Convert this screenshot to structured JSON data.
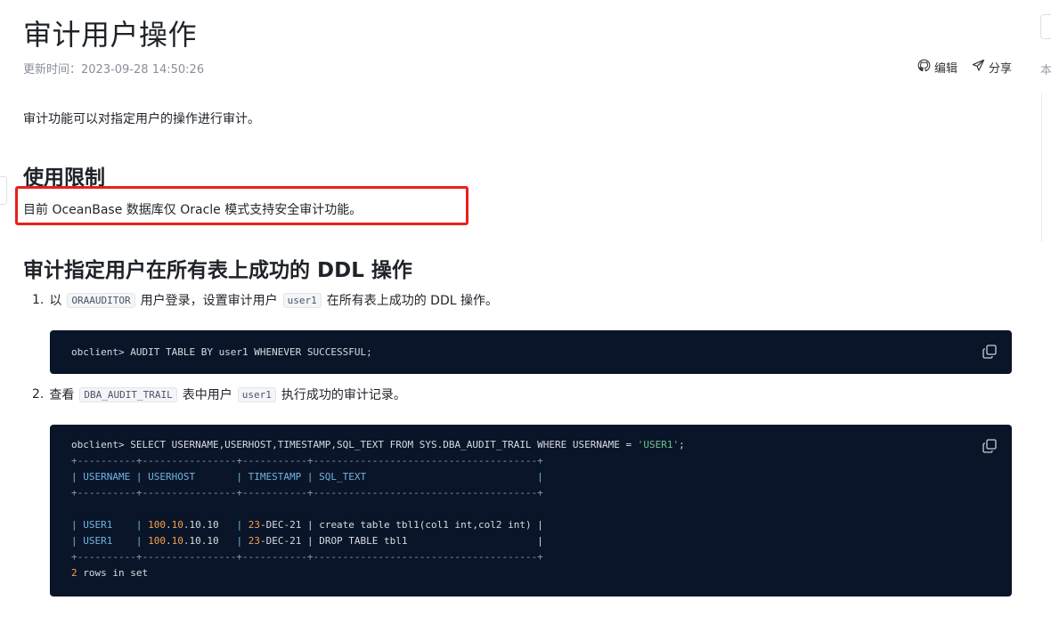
{
  "title": "审计用户操作",
  "meta": {
    "updated_label": "更新时间：",
    "updated_value": "2023-09-28 14:50:26"
  },
  "actions": {
    "edit": "编辑",
    "share": "分享"
  },
  "intro": "审计功能可以对指定用户的操作进行审计。",
  "section_limit": {
    "heading": "使用限制",
    "text": "目前 OceanBase 数据库仅 Oracle 模式支持安全审计功能。"
  },
  "section_audit": {
    "heading": "审计指定用户在所有表上成功的 DDL 操作"
  },
  "steps": [
    {
      "num": "1.",
      "pre": "以",
      "code1": "ORAAUDITOR",
      "mid": "用户登录，设置审计用户",
      "code2": "user1",
      "post": "在所有表上成功的 DDL 操作。"
    },
    {
      "num": "2.",
      "pre": "查看",
      "code1": "DBA_AUDIT_TRAIL",
      "mid": "表中用户",
      "code2": "user1",
      "post": "执行成功的审计记录。"
    }
  ],
  "code1": {
    "line": "obclient> AUDIT TABLE BY user1 WHENEVER SUCCESSFUL;"
  },
  "code2": {
    "q_pre": "obclient> SELECT USERNAME,USERHOST,TIMESTAMP,SQL_TEXT FROM SYS.DBA_AUDIT_TRAIL WHERE USERNAME = ",
    "q_str": "'USER1'",
    "q_end": ";",
    "sep": "+----------+----------------+-----------+--------------------------------------+",
    "header": "| USERNAME | USERHOST       | TIMESTAMP | SQL_TEXT                             |",
    "rows": [
      {
        "user": "| USER1    | ",
        "host_a": "100",
        "host_b": ".",
        "host_c": "10",
        "host_d": ".10.10",
        "pad": "   | ",
        "ts_a": "23",
        "ts_b": "-DEC-21 | create table tbl1(col1 int,col2 int) |"
      },
      {
        "user": "| USER1    | ",
        "host_a": "100",
        "host_b": ".",
        "host_c": "10",
        "host_d": ".10.10",
        "pad": "   | ",
        "ts_a": "23",
        "ts_b": "-DEC-21 | DROP TABLE tbl1                      |"
      }
    ],
    "footer_num": "2",
    "footer_text": " rows in set"
  },
  "sidebar": {
    "fragment": "本"
  },
  "colors": {
    "code_bg": "#0b1529",
    "highlight": "#e8201e",
    "string": "#6cc48a",
    "number": "#f0a04b"
  },
  "icons": {
    "edit": "github-icon",
    "share": "share-icon",
    "copy": "copy-icon"
  }
}
